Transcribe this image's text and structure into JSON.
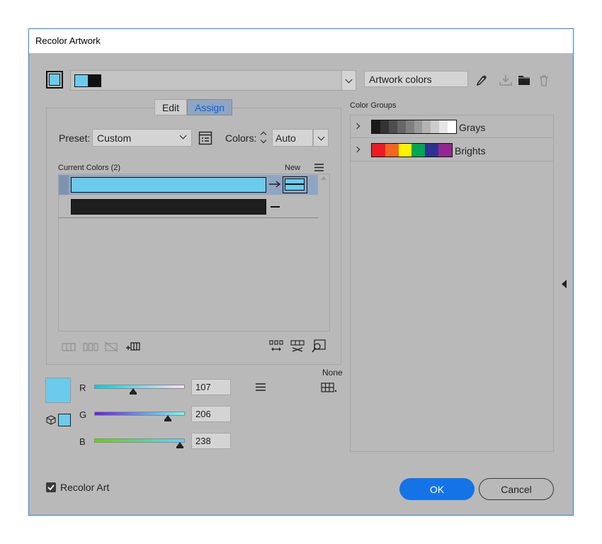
{
  "window": {
    "title": "Recolor Artwork"
  },
  "harmony": {
    "dropdown_value": ""
  },
  "artwork": {
    "name_value": "Artwork colors"
  },
  "tabs": [
    {
      "label": "Edit"
    },
    {
      "label": "Assign"
    }
  ],
  "preset": {
    "label": "Preset:",
    "value": "Custom"
  },
  "colors_count": {
    "label": "Colors:",
    "value": "Auto"
  },
  "current_colors": {
    "header": "Current Colors (2)",
    "new_label": "New",
    "rows": [
      {
        "current": "#6ccbec",
        "new": "#6ccbec",
        "selected": true
      },
      {
        "current": "#1e1e1e",
        "new": "",
        "selected": false
      }
    ]
  },
  "color_groups": {
    "header": "Color Groups",
    "groups": [
      {
        "name": "Grays",
        "swatches": [
          "#1a1a1a",
          "#333333",
          "#4d4d4d",
          "#666666",
          "#808080",
          "#999999",
          "#b3b3b3",
          "#cccccc",
          "#e6e6e6",
          "#ffffff"
        ]
      },
      {
        "name": "Brights",
        "swatches": [
          "#ed1c24",
          "#f26522",
          "#fff200",
          "#00a651",
          "#2e3192",
          "#92278f"
        ]
      }
    ]
  },
  "sliders": {
    "none_label": "None",
    "channels": [
      {
        "label": "R",
        "value": "107"
      },
      {
        "label": "G",
        "value": "206"
      },
      {
        "label": "B",
        "value": "238"
      }
    ],
    "preview_color": "#6ccbec"
  },
  "footer": {
    "recolor_art_label": "Recolor Art",
    "recolor_art_checked": true,
    "ok_label": "OK",
    "cancel_label": "Cancel"
  },
  "colors": {
    "accent": "#1473e6",
    "dialog_bg": "#b9b9b9",
    "selected_row": "#8fa5c3"
  }
}
